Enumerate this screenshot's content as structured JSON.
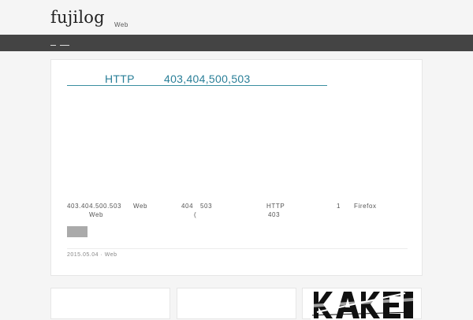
{
  "header": {
    "site_title": "fujilog",
    "tagline": "Web"
  },
  "nav": {
    "items": [
      "",
      ""
    ]
  },
  "post": {
    "title_part1": "HTTP",
    "title_part2": "403,404,500,503",
    "excerpt": {
      "line1": [
        {
          "text": "403.404.500.503",
          "offset": 0
        },
        {
          "text": "Web",
          "offset": 0
        },
        {
          "text": "404",
          "offset": 0
        },
        {
          "text": "503",
          "offset": 0
        },
        {
          "text": "HTTP",
          "offset": 0
        },
        {
          "text": "1",
          "offset": 0
        },
        {
          "text": "Firefox",
          "offset": 0
        }
      ],
      "line2": [
        {
          "text": "Web",
          "offset": 0
        },
        {
          "text": "(",
          "offset": 0
        },
        {
          "text": "403",
          "offset": 0
        }
      ]
    },
    "more_label": "",
    "meta": "2015.05.04 · Web"
  },
  "related": {
    "items": [
      {
        "label": ""
      },
      {
        "label": ""
      },
      {
        "label": ""
      }
    ]
  },
  "colors": {
    "link": "#2a7f98",
    "nav_bg": "#444444",
    "page_bg": "#f5f5f5"
  }
}
